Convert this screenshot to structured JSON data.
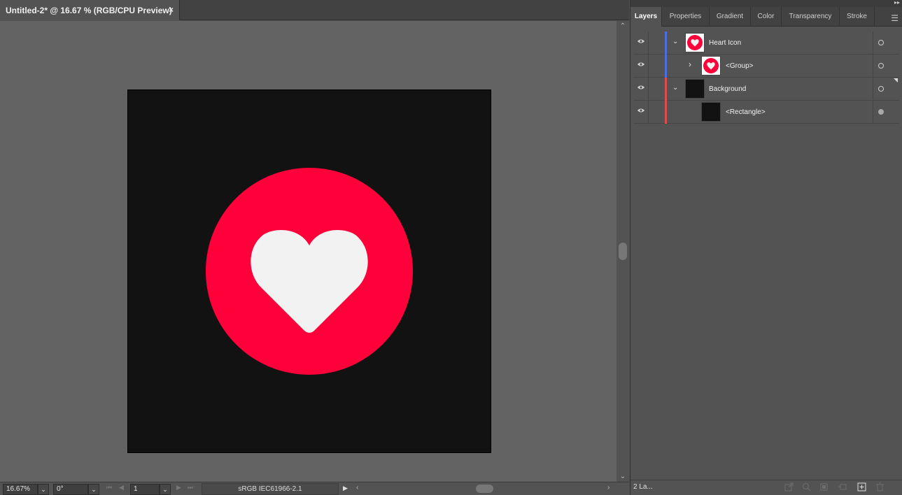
{
  "document": {
    "tab_title": "Untitled-2* @ 16.67 % (RGB/CPU Preview)",
    "close_glyph": "×"
  },
  "artwork": {
    "background_color": "#121212",
    "circle_color": "#ff003b",
    "heart_color": "#f2f2f2"
  },
  "statusbar": {
    "zoom": "16.67%",
    "rotation": "0°",
    "artboard_number": "1",
    "color_profile": "sRGB IEC61966-2.1"
  },
  "panel": {
    "tabs": [
      "Layers",
      "Properties",
      "Gradient",
      "Color",
      "Transparency",
      "Stroke"
    ],
    "active_tab": "Layers",
    "layers": [
      {
        "name": "Heart Icon",
        "type": "layer",
        "expanded": true,
        "color": "#4b6fe0",
        "thumb": "heart",
        "target": "hollow"
      },
      {
        "name": "<Group>",
        "type": "group",
        "expanded": false,
        "color": "#4b6fe0",
        "thumb": "heart",
        "target": "hollow"
      },
      {
        "name": "Background",
        "type": "layer",
        "expanded": true,
        "color": "#e04b4b",
        "thumb": "dark",
        "target": "hollow"
      },
      {
        "name": "<Rectangle>",
        "type": "path",
        "expanded": false,
        "color": "#e04b4b",
        "thumb": "dark",
        "target": "filled"
      }
    ],
    "layer_count": "2 La...",
    "bottom_icons": [
      "export-icon",
      "locate-object-icon",
      "make-clipping-mask-icon",
      "new-sublayer-icon",
      "new-layer-icon",
      "delete-icon"
    ]
  },
  "icons": {
    "expanded": "⌄",
    "collapsed": "›",
    "visibility": "eye-icon",
    "panel_menu": "☰",
    "collapse_panels": "▸▸"
  }
}
